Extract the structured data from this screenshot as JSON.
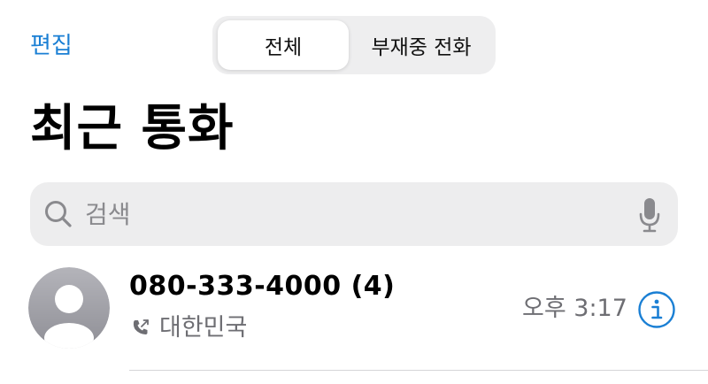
{
  "header": {
    "edit_label": "편집",
    "segments": [
      {
        "label": "전체",
        "selected": true
      },
      {
        "label": "부재중 전화",
        "selected": false
      }
    ]
  },
  "title": "최근 통화",
  "search": {
    "placeholder": "검색",
    "value": "",
    "icon": "search-icon",
    "mic_icon": "microphone-icon"
  },
  "calls": [
    {
      "number": "080-333-4000 (4)",
      "location": "대한민국",
      "time": "오후 3:17",
      "call_icon": "phone-outgoing-icon",
      "info_icon": "info-icon"
    }
  ],
  "colors": {
    "accent": "#1a7fd4",
    "secondary_text": "#6e6e73",
    "search_bg": "#ededee",
    "avatar_bg": "#a7a7ad"
  }
}
